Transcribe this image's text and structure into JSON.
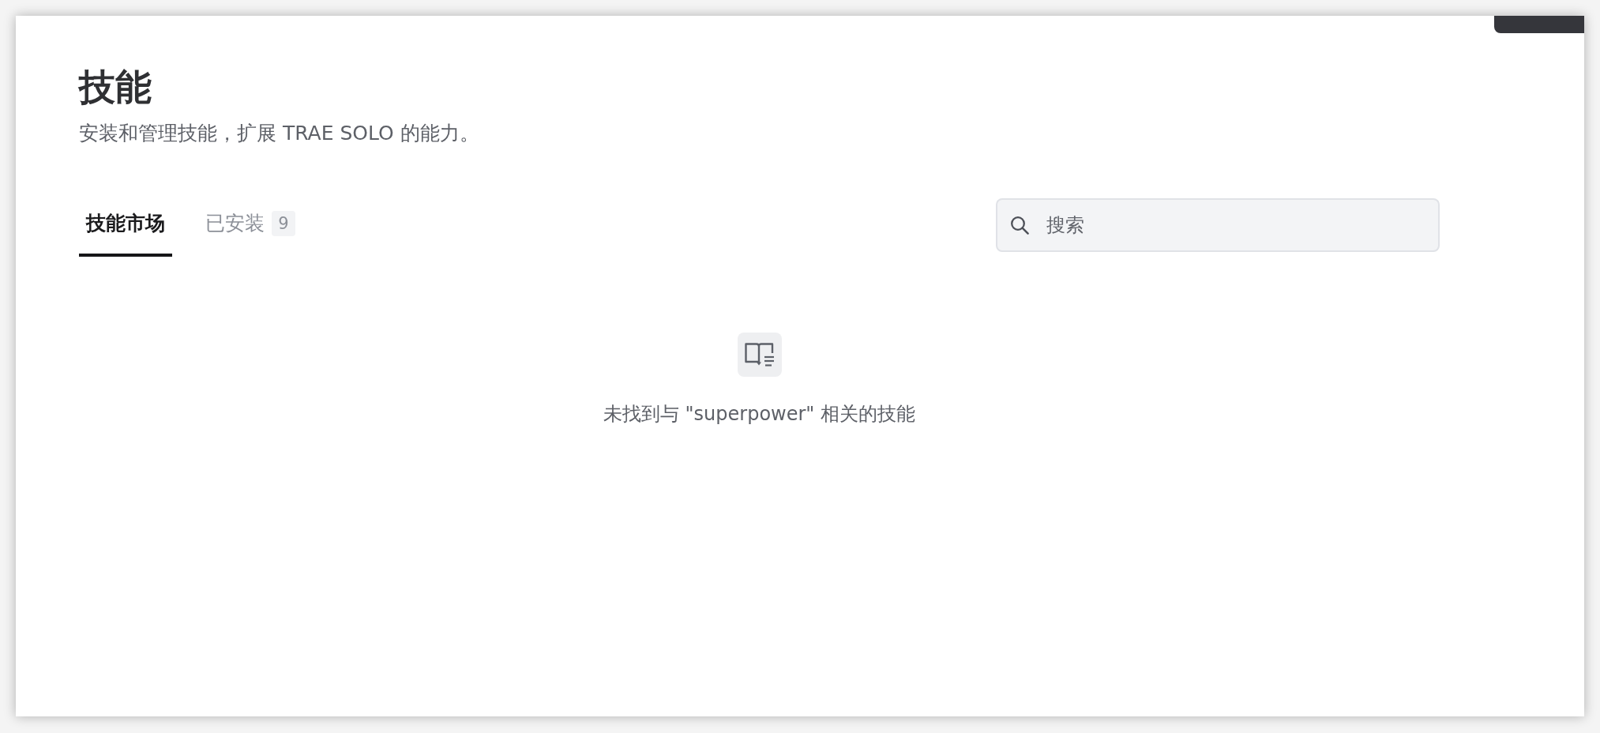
{
  "page": {
    "title": "技能",
    "subtitle": "安装和管理技能，扩展 TRAE SOLO 的能力。"
  },
  "tabs": [
    {
      "label": "技能市场",
      "selected": true
    },
    {
      "label": "已安装",
      "selected": false,
      "count": "9"
    }
  ],
  "search": {
    "placeholder": "搜索"
  },
  "empty_state": {
    "message": "未找到与 \"superpower\" 相关的技能"
  }
}
